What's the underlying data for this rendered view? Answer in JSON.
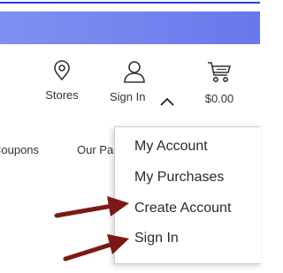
{
  "header": {
    "stores_label": "Stores",
    "signin_label": "Sign In",
    "cart_total": "$0.00",
    "icons": [
      "map-pin-icon",
      "user-icon",
      "chevron-up-icon",
      "cart-icon"
    ]
  },
  "nav": {
    "items": [
      "Coupons",
      "Our Pa"
    ]
  },
  "account_menu": {
    "items": [
      "My Account",
      "My Purchases",
      "Create Account",
      "Sign In"
    ]
  },
  "annotations": {
    "arrow_color": "#7b1a14",
    "arrows_point_to": [
      "Create Account",
      "Sign In"
    ]
  },
  "colors": {
    "banner": "#7384ee",
    "top_rule": "#1f3fe0",
    "text": "#333333"
  }
}
